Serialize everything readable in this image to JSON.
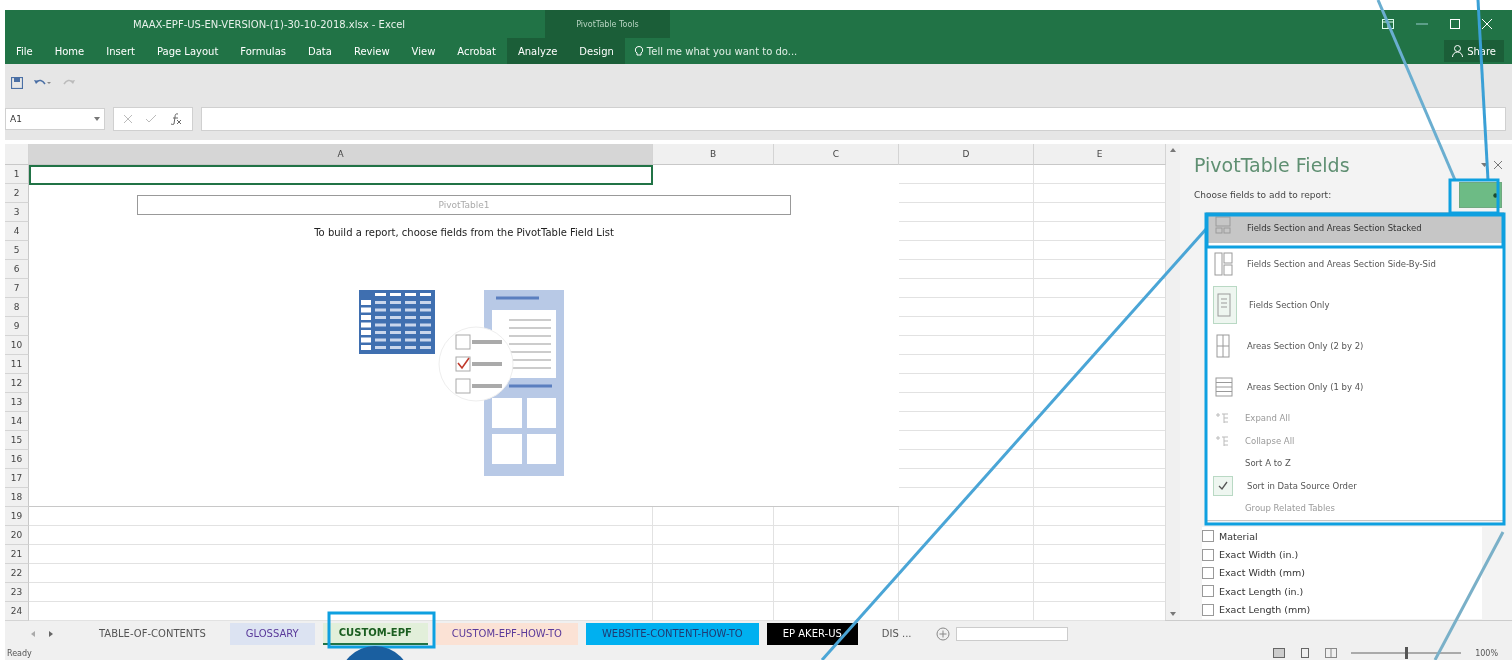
{
  "window": {
    "title": "MAAX-EPF-US-EN-VERSION-(1)-30-10-2018.xlsx - Excel",
    "context_group": "PivotTable Tools",
    "share": "Share"
  },
  "ribbon": {
    "tabs": [
      {
        "label": "File",
        "contextual": false
      },
      {
        "label": "Home",
        "contextual": false
      },
      {
        "label": "Insert",
        "contextual": false
      },
      {
        "label": "Page Layout",
        "contextual": false
      },
      {
        "label": "Formulas",
        "contextual": false
      },
      {
        "label": "Data",
        "contextual": false
      },
      {
        "label": "Review",
        "contextual": false
      },
      {
        "label": "View",
        "contextual": false
      },
      {
        "label": "Acrobat",
        "contextual": false
      },
      {
        "label": "Analyze",
        "contextual": true
      },
      {
        "label": "Design",
        "contextual": true
      }
    ],
    "tell_me": "Tell me what you want to do..."
  },
  "formula_bar": {
    "name_box": "A1"
  },
  "sheet": {
    "columns": [
      "A",
      "B",
      "C",
      "D",
      "E"
    ],
    "rows": [
      "1",
      "2",
      "3",
      "4",
      "5",
      "6",
      "7",
      "8",
      "9",
      "10",
      "11",
      "12",
      "13",
      "14",
      "15",
      "16",
      "17",
      "18",
      "19",
      "20",
      "21",
      "22",
      "23",
      "24"
    ],
    "pivot": {
      "name": "PivotTable1",
      "instruction": "To build a report, choose fields from the PivotTable Field List"
    }
  },
  "field_pane": {
    "title": "PivotTable Fields",
    "subtitle": "Choose fields to add to report:",
    "menu_open": true,
    "fields": [
      {
        "label": "Material",
        "checked": false
      },
      {
        "label": "Exact Width (in.)",
        "checked": false
      },
      {
        "label": "Exact Width (mm)",
        "checked": false
      },
      {
        "label": "Exact Length (in.)",
        "checked": false
      },
      {
        "label": "Exact Length (mm)",
        "checked": false
      }
    ],
    "layout_menu": [
      {
        "kind": "layout",
        "label": "Fields Section and Areas Section Stacked",
        "selected": true,
        "checked": false,
        "disabled": false
      },
      {
        "kind": "layout",
        "label": "Fields Section and Areas Section Side-By-Sid",
        "selected": false,
        "checked": false,
        "disabled": false
      },
      {
        "kind": "layout",
        "label": "Fields Section Only",
        "selected": false,
        "checked": true,
        "disabled": false
      },
      {
        "kind": "layout",
        "label": "Areas Section Only (2 by 2)",
        "selected": false,
        "checked": false,
        "disabled": false
      },
      {
        "kind": "layout",
        "label": "Areas Section Only (1 by 4)",
        "selected": false,
        "checked": false,
        "disabled": false
      },
      {
        "kind": "action",
        "label": "Expand All",
        "selected": false,
        "checked": false,
        "disabled": true
      },
      {
        "kind": "action",
        "label": "Collapse All",
        "selected": false,
        "checked": false,
        "disabled": true
      },
      {
        "kind": "action",
        "label": "Sort A to Z",
        "selected": false,
        "checked": false,
        "disabled": false
      },
      {
        "kind": "action",
        "label": "Sort in Data Source Order",
        "selected": false,
        "checked": true,
        "disabled": false
      },
      {
        "kind": "action",
        "label": "Group Related Tables",
        "selected": false,
        "checked": false,
        "disabled": true
      }
    ]
  },
  "sheet_tabs": [
    {
      "label": "TABLE-OF-CONTENTS",
      "selected": false
    },
    {
      "label": "GLOSSARY",
      "selected": false,
      "color": "#dce3f2"
    },
    {
      "label": "CUSTOM-EPF",
      "selected": true,
      "color": "#e2efda"
    },
    {
      "label": "CUSTOM-EPF-HOW-TO",
      "selected": false,
      "color": "#fbe2d5"
    },
    {
      "label": "WEBSITE-CONTENT-HOW-TO",
      "selected": false,
      "color": "#00b0f0"
    },
    {
      "label": "EP AKER-US",
      "selected": false,
      "color": "#000000"
    },
    {
      "label": "DIS ...",
      "selected": false
    }
  ],
  "status_bar": {
    "status": "Ready",
    "zoom": "100%",
    "zoom_slider": {
      "level": 0.5
    }
  }
}
